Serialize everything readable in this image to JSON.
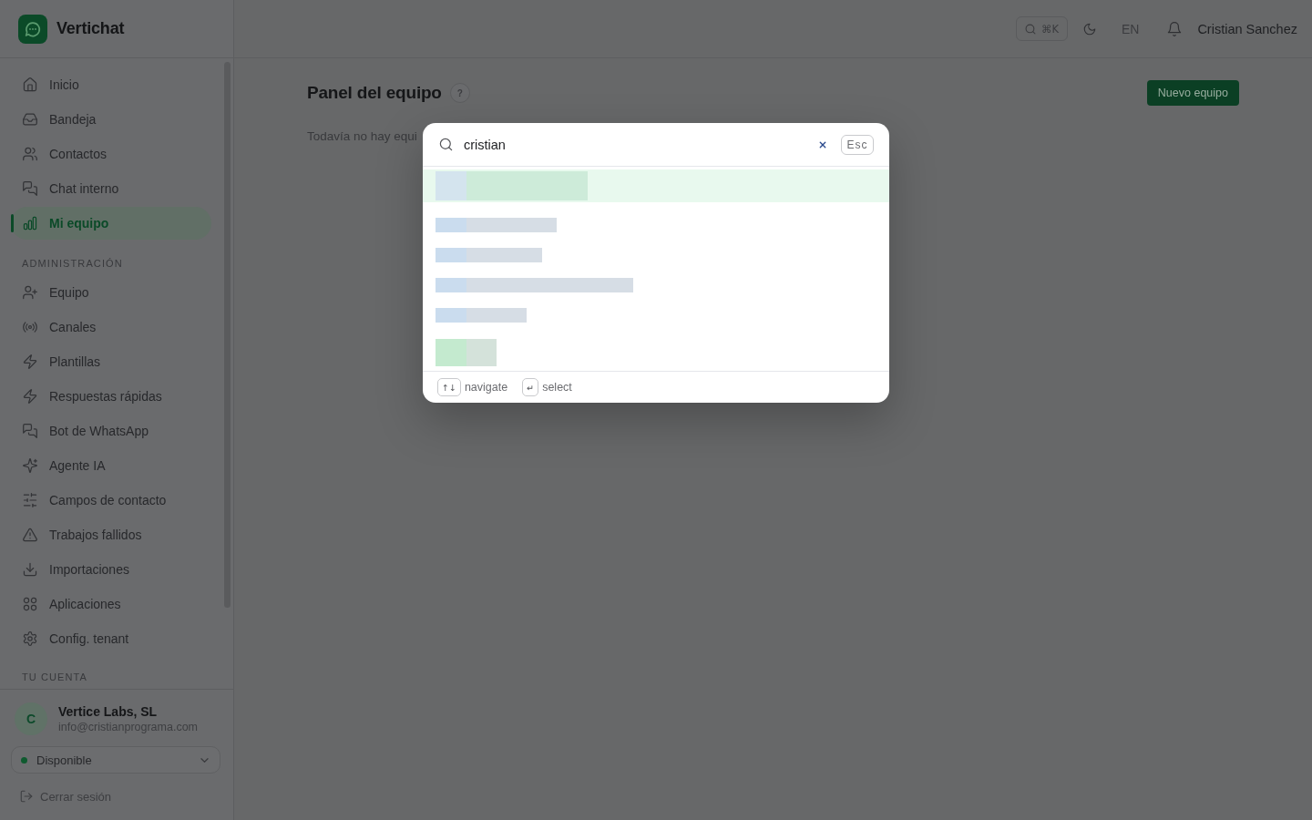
{
  "sidebar": {
    "brand": "Vertichat",
    "main_items": [
      {
        "label": "Inicio",
        "selected": false
      },
      {
        "label": "Bandeja",
        "selected": false
      },
      {
        "label": "Contactos",
        "selected": false
      },
      {
        "label": "Chat interno",
        "selected": false
      },
      {
        "label": "Mi equipo",
        "selected": true
      }
    ],
    "admin_section": {
      "title": "ADMINISTRACIÓN",
      "items": [
        {
          "label": "Equipo",
          "selected": false
        },
        {
          "label": "Canales",
          "selected": false
        },
        {
          "label": "Plantillas",
          "selected": false
        },
        {
          "label": "Respuestas rápidas",
          "selected": false
        },
        {
          "label": "Bot de WhatsApp",
          "selected": false
        },
        {
          "label": "Agente IA",
          "selected": false
        },
        {
          "label": "Campos de contacto",
          "selected": false
        },
        {
          "label": "Trabajos fallidos",
          "selected": false
        },
        {
          "label": "Importaciones",
          "selected": false
        },
        {
          "label": "Aplicaciones",
          "selected": false
        },
        {
          "label": "Config. tenant",
          "selected": false
        }
      ]
    },
    "account_section": {
      "title": "TU CUENTA"
    },
    "account": {
      "initial": "C",
      "name": "Vertice Labs, SL",
      "email": "info@cristianprograma.com"
    },
    "availability": {
      "label": "Disponible",
      "online": true
    },
    "logout": "Cerrar sesión"
  },
  "header": {
    "search_shortcut": "⌘K",
    "language": "EN",
    "user_name": "Cristian Sanchez"
  },
  "main": {
    "title": "Panel del equipo",
    "help": "?",
    "primary_button": "Nuevo equipo",
    "empty_text": "Todavía no hay equi"
  },
  "search_dialog": {
    "query": "cristian",
    "close_key": "Esc",
    "results": [
      {
        "selected": true,
        "color": "#d4e4ee"
      },
      {
        "selected": false,
        "color": "#cadcee"
      },
      {
        "selected": false,
        "color": "#cadcee"
      },
      {
        "selected": false,
        "color": "#cadcee"
      },
      {
        "selected": false,
        "color": "#cadcee"
      },
      {
        "selected": false,
        "color": "#c4eacf"
      }
    ],
    "hints": [
      {
        "key": "↑↓",
        "label": "navigate"
      },
      {
        "key": "↵",
        "label": "select"
      }
    ]
  }
}
